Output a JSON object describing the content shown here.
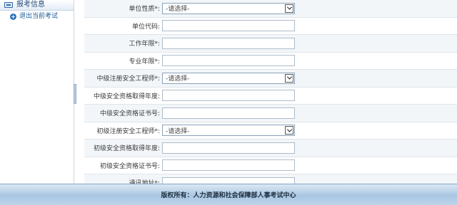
{
  "sidebar": {
    "header": "报考信息",
    "items": [
      {
        "label": "退出当前考试"
      }
    ]
  },
  "form": {
    "rows": [
      {
        "label": "单位性质*:",
        "type": "select",
        "value": "-请选择-"
      },
      {
        "label": "单位代码:",
        "type": "input",
        "value": ""
      },
      {
        "label": "工作年限*:",
        "type": "input",
        "value": ""
      },
      {
        "label": "专业年限*:",
        "type": "input",
        "value": ""
      },
      {
        "label": "中级注册安全工程师*:",
        "type": "select",
        "value": "-请选择-"
      },
      {
        "label": "中级安全资格取得年度:",
        "type": "input",
        "value": ""
      },
      {
        "label": "中级安全资格证书号:",
        "type": "input",
        "value": ""
      },
      {
        "label": "初级注册安全工程师*:",
        "type": "select",
        "value": "-请选择-"
      },
      {
        "label": "初级安全资格取得年度:",
        "type": "input",
        "value": ""
      },
      {
        "label": "初级安全资格证书号:",
        "type": "input",
        "value": ""
      },
      {
        "label": "通讯地址*:",
        "type": "input",
        "value": ""
      }
    ]
  },
  "footer": {
    "text": "版权所有：人力资源和社会保障部人事考试中心"
  },
  "colors": {
    "accent": "#2b73b8",
    "footer_bg": "#a9c6e2",
    "row_alt": "#f3f6f9"
  }
}
